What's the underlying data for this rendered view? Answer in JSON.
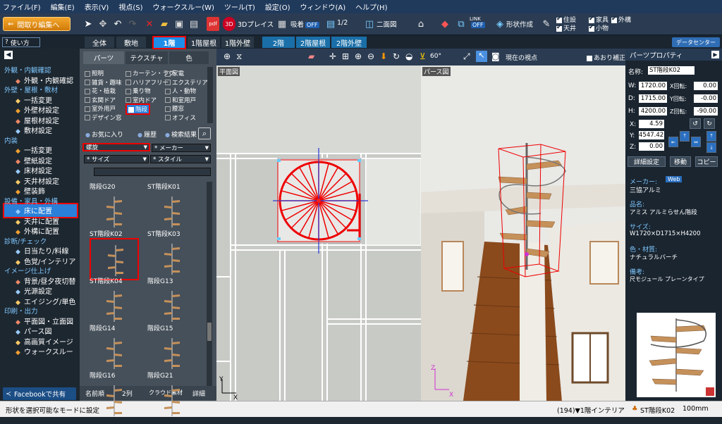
{
  "menu": [
    "ファイル(F)",
    "編集(E)",
    "表示(V)",
    "視点(S)",
    "ウォークスルー(W)",
    "ツール(T)",
    "設定(O)",
    "ウィンドウ(A)",
    "ヘルプ(H)"
  ],
  "toolbar": {
    "back_label": "間取り編集へ",
    "threed_label": "3Dプレイス",
    "snap_label": "吸着",
    "snap_state": "OFF",
    "grid_value": "1/2",
    "view_split": "二面図",
    "link_label": "LINK",
    "link_state": "OFF",
    "shape_label": "形状作成",
    "checks": [
      {
        "label": "住設",
        "on": true
      },
      {
        "label": "家具",
        "on": true
      },
      {
        "label": "外構",
        "on": true
      },
      {
        "label": "天井",
        "on": true
      },
      {
        "label": "小物",
        "on": true
      }
    ]
  },
  "floor_tabs": [
    "全体",
    "敷地",
    "1階",
    "1階屋根",
    "1階外壁",
    "2階",
    "2階屋根",
    "2階外壁"
  ],
  "help_label": "使い方",
  "data_center": "データセンター",
  "nav": [
    {
      "t": "h",
      "label": "外観・内観確認"
    },
    {
      "t": "i",
      "icon": "house-view-icon",
      "label": "外観・内観確認"
    },
    {
      "t": "h",
      "label": "外壁・屋根・敷材"
    },
    {
      "t": "i",
      "icon": "change-icon",
      "label": "一括変更"
    },
    {
      "t": "i",
      "icon": "wall-icon",
      "label": "外壁材設定"
    },
    {
      "t": "i",
      "icon": "roof-icon",
      "label": "屋根材設定"
    },
    {
      "t": "i",
      "icon": "floor-material-icon",
      "label": "敷材設定"
    },
    {
      "t": "h",
      "label": "内装"
    },
    {
      "t": "i",
      "icon": "change-icon",
      "label": "一括変更"
    },
    {
      "t": "i",
      "icon": "wallpaper-icon",
      "label": "壁紙設定"
    },
    {
      "t": "i",
      "icon": "flooring-icon",
      "label": "床材設定"
    },
    {
      "t": "i",
      "icon": "ceiling-icon",
      "label": "天井材設定"
    },
    {
      "t": "i",
      "icon": "decor-icon",
      "label": "壁装飾"
    },
    {
      "t": "h",
      "label": "設備・家具・外構"
    },
    {
      "t": "i",
      "icon": "floor-place-icon",
      "label": "床に配置"
    },
    {
      "t": "i",
      "icon": "ceiling-place-icon",
      "label": "天井に配置"
    },
    {
      "t": "i",
      "icon": "exterior-place-icon",
      "label": "外構に配置"
    },
    {
      "t": "h",
      "label": "診断/チェック"
    },
    {
      "t": "i",
      "icon": "sunlight-icon",
      "label": "日当たり/料線"
    },
    {
      "t": "i",
      "icon": "color-icon",
      "label": "色覚/インテリア"
    },
    {
      "t": "h",
      "label": "イメージ仕上げ"
    },
    {
      "t": "i",
      "icon": "background-icon",
      "label": "背景/昼夕夜切替"
    },
    {
      "t": "i",
      "icon": "light-icon",
      "label": "光源設定"
    },
    {
      "t": "i",
      "icon": "aging-icon",
      "label": "エイジング/単色"
    },
    {
      "t": "h",
      "label": "印刷・出力"
    },
    {
      "t": "i",
      "icon": "plan-icon",
      "label": "平面図・立面図"
    },
    {
      "t": "i",
      "icon": "perspective-icon",
      "label": "パース図"
    },
    {
      "t": "i",
      "icon": "hq-icon",
      "label": "高画質イメージ"
    },
    {
      "t": "i",
      "icon": "walk-icon",
      "label": "ウォークスルー"
    }
  ],
  "facebook_label": "Facebookで共有",
  "panel": {
    "tabs": [
      "パーツ",
      "テクスチャ",
      "色"
    ],
    "categories": [
      [
        "照明",
        "カーテン・ラグ",
        "家電"
      ],
      [
        "雑貨・趣味",
        "ハリアフリー",
        "エクステリア"
      ],
      [
        "花・植栽",
        "乗り物",
        "人・動物"
      ],
      [
        "玄関ドア",
        "室内ドア",
        "和室用戸"
      ],
      [
        "室外用戸",
        "階段",
        "腰窓"
      ],
      [
        "デザイン窓",
        "",
        "オフィス"
      ]
    ],
    "radios": [
      "お気に入り",
      "履歴",
      "検索結果"
    ],
    "filter1": "螺旋",
    "filter2": "* メーカー",
    "filter3": "* サイズ",
    "filter4": "* スタイル",
    "items": [
      "階段G20",
      "ST階段K01",
      "ST階段K02",
      "ST階段K03",
      "ST階段K04",
      "階段G13",
      "階段G14",
      "階段G15",
      "階段G16",
      "階段G21"
    ],
    "sort": "名前順",
    "cols": "2列",
    "cloud": "クラウド素材",
    "detail": "詳細"
  },
  "view": {
    "angle": "60°",
    "viewpoint": "現在の視点",
    "auto_label": "あおり補正",
    "plan_label": "平面図",
    "pers_label": "パース図"
  },
  "props": {
    "title": "パーツプロパティ",
    "name_label": "名称:",
    "name": "ST階段K02",
    "W": "1720.00",
    "D": "1715.00",
    "H": "4200.00",
    "xr": "0.00",
    "yr": "-0.00",
    "zr": "-90.00",
    "X": "4.59",
    "Y": "4547.42",
    "Z": "0.00",
    "xr_label": "X回転:",
    "yr_label": "Y回転:",
    "zr_label": "Z回転:",
    "detail_btn": "詳細設定",
    "move_btn": "移動",
    "copy_btn": "コピー",
    "maker_label": "メーカー:",
    "web": "Web",
    "maker": "三協アルミ",
    "product_label": "品名:",
    "product": "アミス アルミらせん階段",
    "size_label": "サイズ:",
    "size": "W1720×D1715×H4200",
    "color_label": "色・材質:",
    "color": "ナチュラルバーチ",
    "note_label": "備考:",
    "note": "尺モジュール プレーンタイプ"
  },
  "status": {
    "left": "形状を選択可能なモードに設定",
    "right": "(194)▼1階インテリア",
    "part": "ST階段K02",
    "unit": "100mm"
  }
}
